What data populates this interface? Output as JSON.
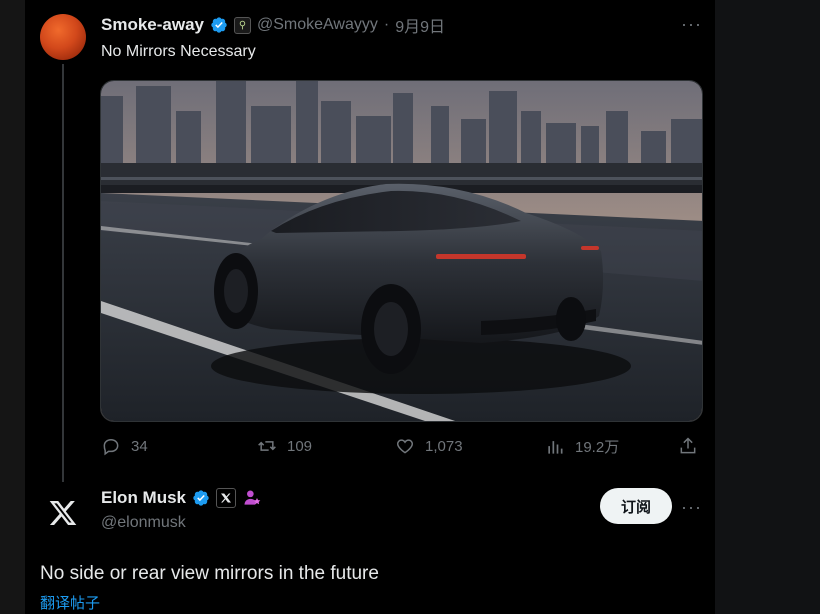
{
  "tweet1": {
    "author_name": "Smoke-away",
    "handle": "@SmokeAwayyy",
    "separator": "·",
    "date": "9月9日",
    "text": "No Mirrors Necessary",
    "stats": {
      "replies": "34",
      "retweets": "109",
      "likes": "1,073",
      "views": "19.2万"
    },
    "icons": {
      "avatar": "sun-avatar",
      "verified": "verified-badge-icon",
      "reply": "reply-icon",
      "retweet": "retweet-icon",
      "like": "heart-icon",
      "views": "views-bar-icon",
      "share": "share-icon",
      "more": "more-icon"
    }
  },
  "tweet2": {
    "author_name": "Elon Musk",
    "handle": "@elonmusk",
    "subscribe_label": "订阅",
    "text": "No side or rear view mirrors in the future",
    "translate_label": "翻译帖子"
  },
  "colors": {
    "background": "#000000",
    "primary_text": "#e7e9ea",
    "secondary_text": "#71767b",
    "link": "#1d9bf0",
    "verified": "#1d9bf0"
  }
}
